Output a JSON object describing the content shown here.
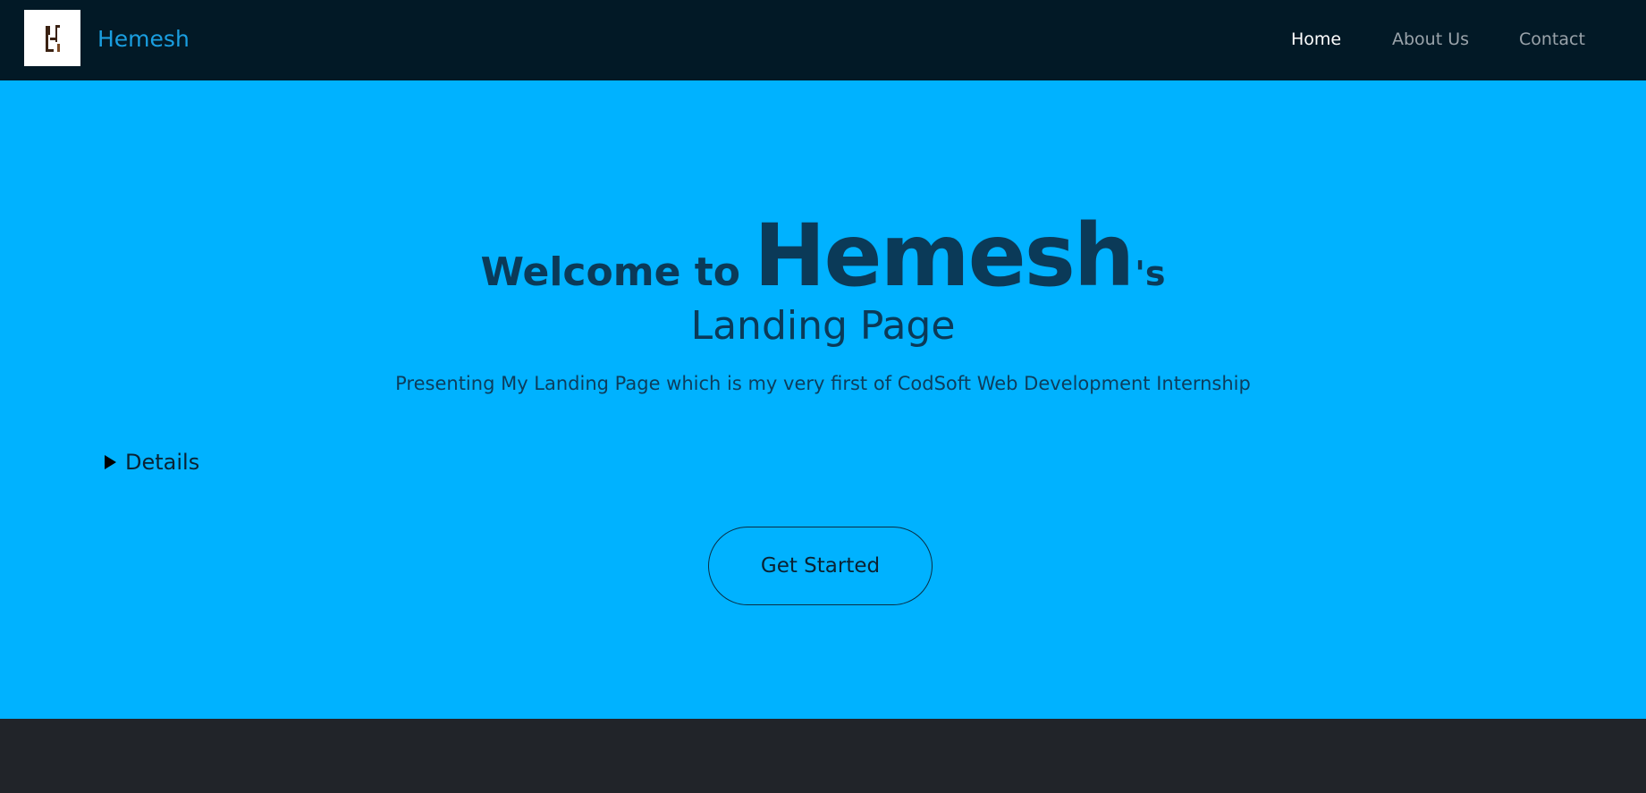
{
  "navbar": {
    "brand": "Hemesh",
    "logo_icon": "H-monogram-icon",
    "links": [
      {
        "label": "Home",
        "active": true
      },
      {
        "label": "About Us",
        "active": false
      },
      {
        "label": "Contact",
        "active": false
      }
    ]
  },
  "hero": {
    "welcome": "Welcome to",
    "name": "Hemesh",
    "possessive": "'s",
    "title_line2": "Landing Page",
    "subtitle": "Presenting My Landing Page which is my very first of CodSoft Web Development Internship",
    "details_label": "Details",
    "cta_label": "Get Started"
  },
  "colors": {
    "navbar_bg": "#021926",
    "hero_bg": "#00b2ff",
    "footer_bg": "#212429",
    "brand": "#1a9ee0",
    "headline": "#0b3a58"
  }
}
